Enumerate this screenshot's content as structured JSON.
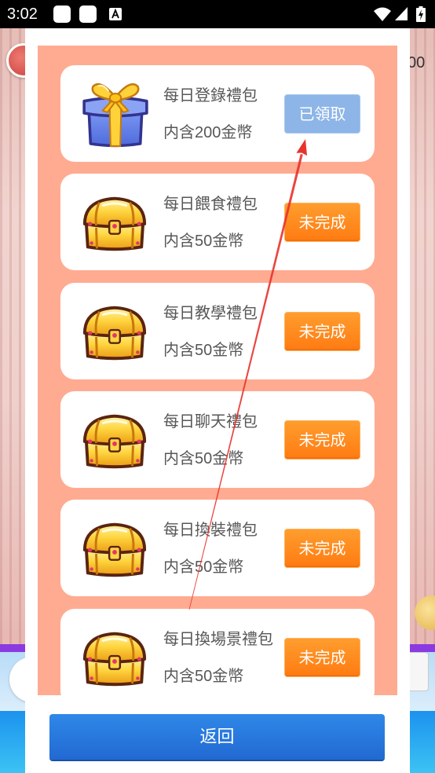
{
  "status_bar": {
    "time": "3:02"
  },
  "background": {
    "counter_fragment": "00"
  },
  "tasks": [
    {
      "title": "每日登錄禮包",
      "reward": "内含200金幣",
      "button": "已領取",
      "icon": "gift-box-icon"
    },
    {
      "title": "每日餵食禮包",
      "reward": "内含50金幣",
      "button": "未完成",
      "icon": "treasure-chest-icon"
    },
    {
      "title": "每日教學禮包",
      "reward": "内含50金幣",
      "button": "未完成",
      "icon": "treasure-chest-icon"
    },
    {
      "title": "每日聊天禮包",
      "reward": "内含50金幣",
      "button": "未完成",
      "icon": "treasure-chest-icon"
    },
    {
      "title": "每日換裝禮包",
      "reward": "内含50金幣",
      "button": "未完成",
      "icon": "treasure-chest-icon"
    },
    {
      "title": "每日換場景禮包",
      "reward": "内含50金幣",
      "button": "未完成",
      "icon": "treasure-chest-icon"
    }
  ],
  "back_button": {
    "label": "返回"
  },
  "colors": {
    "list_background": "#ffab91",
    "claimed_button": "#8db5e7",
    "incomplete_button_top": "#ff9d2e",
    "incomplete_button_bottom": "#ff7b12",
    "back_button_top": "#2f88e8",
    "back_button_bottom": "#2169d2",
    "annotation_arrow": "#e8322c"
  }
}
